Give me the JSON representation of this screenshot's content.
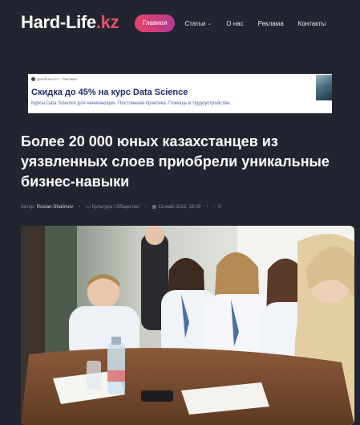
{
  "header": {
    "logo_main": "Hard-Life",
    "logo_suffix": ".kz",
    "nav": [
      {
        "label": "Главная",
        "active": true
      },
      {
        "label": "Статьи",
        "dropdown": true
      },
      {
        "label": "О нас"
      },
      {
        "label": "Реклама"
      },
      {
        "label": "Контакты"
      }
    ]
  },
  "ad": {
    "source": "geekbrains.kz · Реклама",
    "title": "Скидка до 45% на курс Data Science",
    "description": "Курсы Data Scientist для начинающих. Постоянная практика. Помощь в трудоустройстве.",
    "menu_icon": "kebab-icon"
  },
  "article": {
    "title": "Более 20 000 юных казахстанцев из уязвленных слоев приобрели уникальные бизнес-навыки",
    "author_label": "Автор:",
    "author": "Ruslan-Shalimov",
    "category": "Культура / Общество",
    "date": "13-май-2022, 18:09",
    "comments": "0"
  },
  "colors": {
    "background": "#22252f",
    "accent": "#e94e6b",
    "nav_active_gradient": [
      "#e8436a",
      "#b23a8f"
    ],
    "ad_title": "#1e2a6a",
    "ad_text": "#5060a8"
  }
}
